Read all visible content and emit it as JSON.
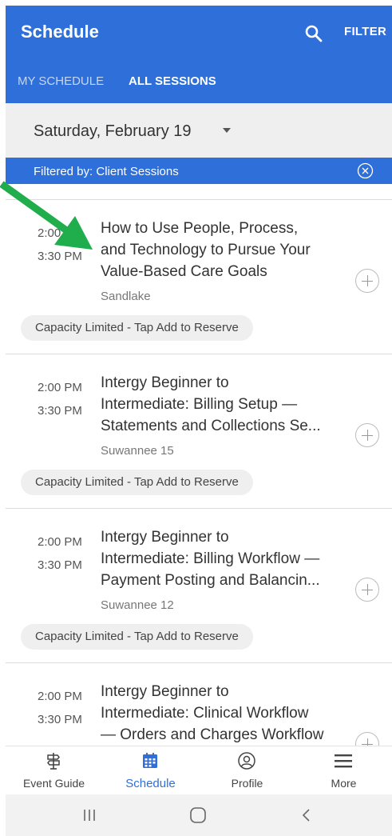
{
  "header": {
    "title": "Schedule",
    "filter_label": "FILTER",
    "tabs": [
      {
        "label": "MY SCHEDULE",
        "active": false
      },
      {
        "label": "ALL SESSIONS",
        "active": true
      }
    ],
    "brand_color": "#2f6fd9"
  },
  "date_selector": {
    "value": "Saturday, February 19"
  },
  "filter_banner": {
    "text": "Filtered by: Client Sessions"
  },
  "sessions": [
    {
      "start": "2:00 PM",
      "end": "3:30 PM",
      "title_lines": [
        "How to Use People, Process,",
        "and Technology to Pursue Your",
        "Value-Based Care Goals"
      ],
      "room": "Sandlake",
      "capacity": "Capacity Limited - Tap Add to Reserve"
    },
    {
      "start": "2:00 PM",
      "end": "3:30 PM",
      "title_lines": [
        "Intergy Beginner to",
        "Intermediate: Billing Setup —",
        "Statements and Collections Se..."
      ],
      "room": "Suwannee 15",
      "capacity": "Capacity Limited - Tap Add to Reserve"
    },
    {
      "start": "2:00 PM",
      "end": "3:30 PM",
      "title_lines": [
        "Intergy Beginner to",
        "Intermediate: Billing Workflow —",
        "Payment Posting and Balancin..."
      ],
      "room": "Suwannee 12",
      "capacity": "Capacity Limited - Tap Add to Reserve"
    },
    {
      "start": "2:00 PM",
      "end": "3:30 PM",
      "title_lines": [
        "Intergy Beginner to",
        "Intermediate: Clinical Workflow",
        "— Orders and Charges Workflow"
      ],
      "room": "",
      "capacity": ""
    }
  ],
  "bottom_nav": [
    {
      "label": "Event Guide",
      "icon": "signpost-icon",
      "active": false
    },
    {
      "label": "Schedule",
      "icon": "calendar-icon",
      "active": true
    },
    {
      "label": "Profile",
      "icon": "profile-icon",
      "active": false
    },
    {
      "label": "More",
      "icon": "menu-icon",
      "active": false
    }
  ],
  "annotation_arrow_color": "#1fae4b"
}
